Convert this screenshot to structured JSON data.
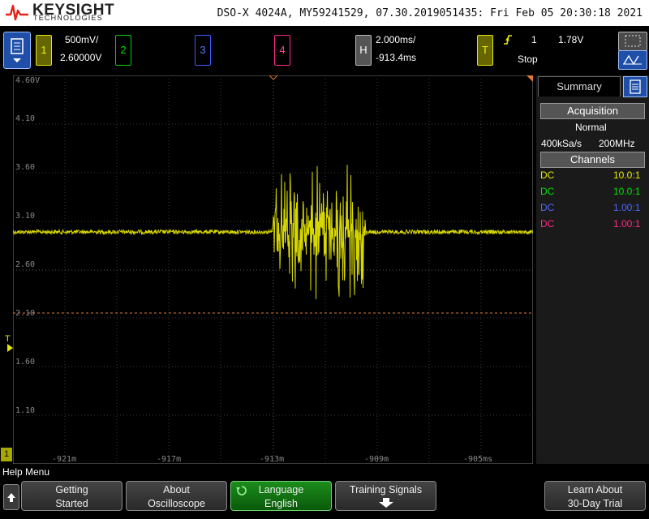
{
  "titlebar": {
    "brand": "KEYSIGHT",
    "brand_sub": "TECHNOLOGIES",
    "info": "DSO-X 4024A, MY59241529, 07.30.2019051435: Fri Feb 05 20:30:18 2021"
  },
  "channels": {
    "ch1": {
      "label": "1",
      "scale": "500mV/",
      "offset": "2.60000V"
    },
    "ch2": {
      "label": "2"
    },
    "ch3": {
      "label": "3"
    },
    "ch4": {
      "label": "4"
    }
  },
  "horizontal": {
    "label": "H",
    "scale": "2.000ms/",
    "delay": "-913.4ms"
  },
  "trigger": {
    "label": "T",
    "source": "1",
    "level": "1.78V",
    "status": "Stop"
  },
  "graticule": {
    "y_labels": [
      "4.60V",
      "4.10",
      "3.60",
      "3.10",
      "2.60",
      "2.10",
      "1.60",
      "1.10"
    ],
    "x_labels": [
      "-921m",
      "-917m",
      "-913m",
      "-909m",
      "-905ms"
    ],
    "trig_marker": "T",
    "ch1_marker": "1"
  },
  "panel": {
    "summary_tab": "Summary",
    "acquisition_header": "Acquisition",
    "mode": "Normal",
    "sample_rate": "400kSa/s",
    "bandwidth": "200MHz",
    "channels_header": "Channels",
    "rows": [
      {
        "coupling": "DC",
        "probe": "10.0:1",
        "color": "#e8e800"
      },
      {
        "coupling": "DC",
        "probe": "10.0:1",
        "color": "#00e000"
      },
      {
        "coupling": "DC",
        "probe": "1.00:1",
        "color": "#4a6bff"
      },
      {
        "coupling": "DC",
        "probe": "1.00:1",
        "color": "#ff2a8a"
      }
    ]
  },
  "help_menu": "Help Menu",
  "softkeys": {
    "getting_started": [
      "Getting",
      "Started"
    ],
    "about": [
      "About",
      "Oscilloscope"
    ],
    "language": [
      "Language",
      "English"
    ],
    "training": [
      "Training Signals"
    ],
    "learn": [
      "Learn About",
      "30-Day Trial"
    ]
  },
  "colors": {
    "ch1": "#e8e800",
    "ch2": "#00e000",
    "ch3": "#4a6bff",
    "ch4": "#ff2a8a",
    "accent": "#1f4fa8"
  }
}
